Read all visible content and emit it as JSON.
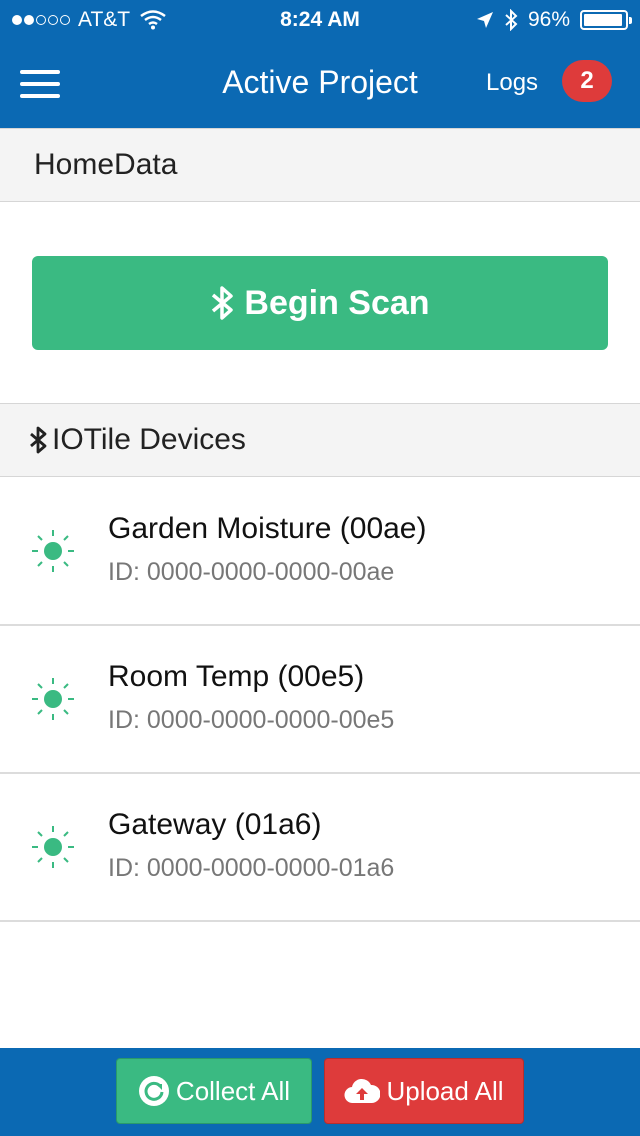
{
  "status_bar": {
    "carrier": "AT&T",
    "time": "8:24 AM",
    "battery": "96%",
    "signal_bars_filled": 2,
    "signal_bars_total": 5,
    "battery_level": 0.96
  },
  "nav": {
    "title": "Active Project",
    "logs_label": "Logs",
    "logs_count": "2"
  },
  "project": {
    "name": "HomeData"
  },
  "scan": {
    "label": "Begin Scan"
  },
  "devices_section": {
    "title": "IOTile Devices"
  },
  "devices": [
    {
      "name": "Garden Moisture (00ae)",
      "id": "ID: 0000-0000-0000-00ae"
    },
    {
      "name": "Room Temp (00e5)",
      "id": "ID: 0000-0000-0000-00e5"
    },
    {
      "name": "Gateway (01a6)",
      "id": "ID: 0000-0000-0000-01a6"
    }
  ],
  "footer": {
    "collect_label": "Collect All",
    "upload_label": "Upload All"
  },
  "colors": {
    "primary": "#0b69b3",
    "success": "#3aba82",
    "danger": "#de3b3b"
  },
  "icons": {
    "menu": "hamburger-icon",
    "bluetooth": "bluetooth-icon",
    "device": "sun-icon",
    "collect": "refresh-icon",
    "upload": "cloud-upload-icon"
  }
}
